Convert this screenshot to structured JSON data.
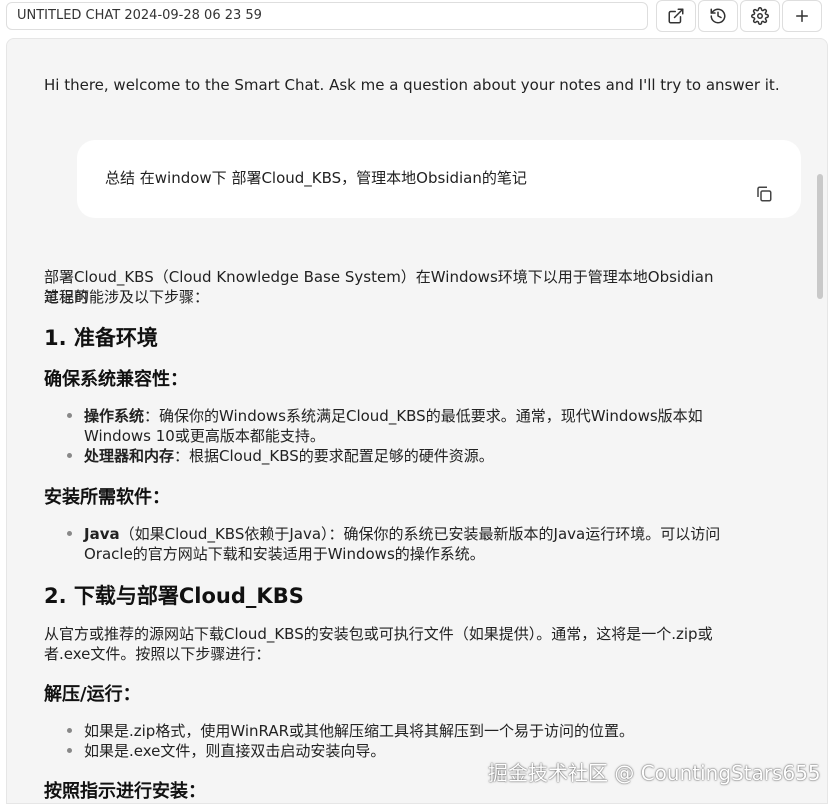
{
  "header": {
    "chat_title": "UNTITLED CHAT 2024-09-28 06 23 59",
    "buttons": [
      {
        "name": "open-external",
        "icon": "external-link-icon"
      },
      {
        "name": "history",
        "icon": "history-icon"
      },
      {
        "name": "settings",
        "icon": "gear-icon"
      },
      {
        "name": "new-chat",
        "icon": "plus-icon"
      }
    ]
  },
  "chat": {
    "welcome": "Hi there, welcome to the Smart Chat. Ask me a question about your notes and I'll try to answer it.",
    "user_message": "总结 在window下 部署Cloud_KBS，管理本地Obsidian的笔记",
    "response": {
      "intro_line1": "部署Cloud_KBS（Cloud Knowledge Base System）在Windows环境下以用于管理本地Obsidian笔记的",
      "intro_line2": "过程可能涉及以下步骤：",
      "h_prepare": "1. 准备环境",
      "h_compat": "确保系统兼容性：",
      "compat_items": [
        {
          "label": "操作系统",
          "line1": "：确保你的Windows系统满足Cloud_KBS的最低要求。通常，现代Windows版本如",
          "line2": "Windows 10或更高版本都能支持。"
        },
        {
          "label": "处理器和内存",
          "line1": "：根据Cloud_KBS的要求配置足够的硬件资源。"
        }
      ],
      "h_software": "安装所需软件：",
      "software_items": [
        {
          "label": "Java",
          "line1": "（如果Cloud_KBS依赖于Java）：确保你的系统已安装最新版本的Java运行环境。可以访问",
          "line2": "Oracle的官方网站下载和安装适用于Windows的操作系统。"
        }
      ],
      "h_download": "2. 下载与部署Cloud_KBS",
      "download_line1": "从官方或推荐的源网站下载Cloud_KBS的安装包或可执行文件（如果提供）。通常，这将是一个.zip或",
      "download_line2": "者.exe文件。按照以下步骤进行：",
      "h_unzip": "解压/运行：",
      "unzip_items": [
        "如果是.zip格式，使用WinRAR或其他解压缩工具将其解压到一个易于访问的位置。",
        "如果是.exe文件，则直接双击启动安装向导。"
      ],
      "h_follow": "按照指示进行安装："
    }
  },
  "watermark": "掘金技术社区 @ CountingStars655"
}
